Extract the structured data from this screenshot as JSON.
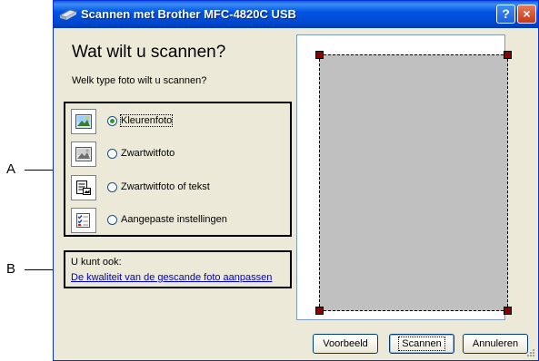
{
  "window": {
    "title": "Scannen met Brother MFC-4820C USB",
    "help_glyph": "?",
    "close_glyph": "×"
  },
  "heading": "Wat wilt u scannen?",
  "subheading": "Welk type foto wilt u scannen?",
  "options": [
    {
      "label": "Kleurenfoto",
      "icon": "color-photo-icon",
      "selected": true
    },
    {
      "label": "Zwartwitfoto",
      "icon": "grayscale-photo-icon",
      "selected": false
    },
    {
      "label": "Zwartwitfoto of tekst",
      "icon": "bw-text-icon",
      "selected": false
    },
    {
      "label": "Aangepaste instellingen",
      "icon": "custom-settings-icon",
      "selected": false
    }
  ],
  "also": {
    "label": "U kunt ook:",
    "link": "De kwaliteit van de gescande foto aanpassen"
  },
  "buttons": {
    "preview": "Voorbeeld",
    "scan": "Scannen",
    "cancel": "Annuleren"
  },
  "callouts": {
    "a": "A",
    "b": "B"
  },
  "colors": {
    "titlebar": "#0055e5",
    "dialog_bg": "#ece9d8",
    "link": "#0000cc",
    "handle": "#8b0000"
  }
}
